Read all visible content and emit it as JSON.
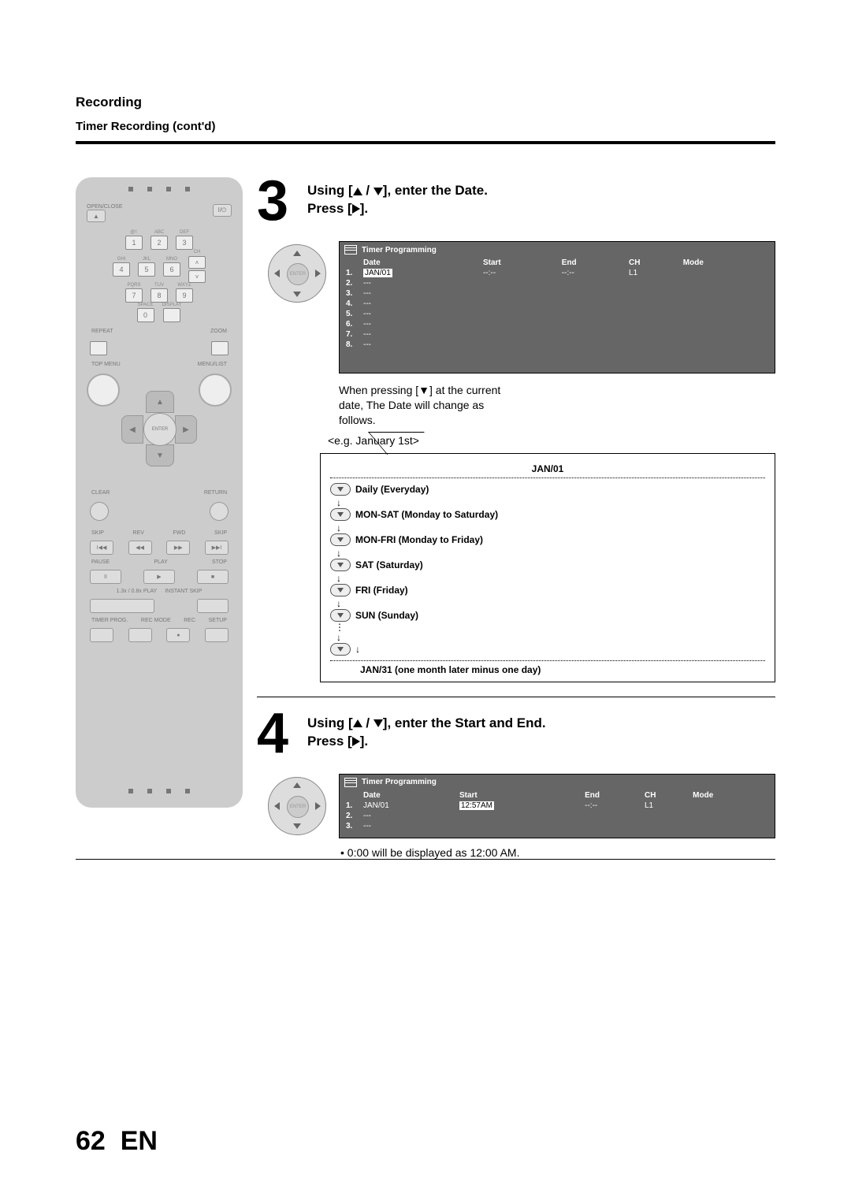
{
  "header": {
    "section": "Recording",
    "subsection": "Timer Recording (cont'd)"
  },
  "remote": {
    "open_close": "OPEN/CLOSE",
    "keypad": {
      "r1": [
        {
          "l": "@!:",
          "n": "1"
        },
        {
          "l": "ABC",
          "n": "2"
        },
        {
          "l": "DEF",
          "n": "3"
        }
      ],
      "r2": [
        {
          "l": "GHI",
          "n": "4"
        },
        {
          "l": "JKL",
          "n": "5"
        },
        {
          "l": "MNO",
          "n": "6"
        }
      ],
      "r3": [
        {
          "l": "PQRS",
          "n": "7"
        },
        {
          "l": "TUV",
          "n": "8"
        },
        {
          "l": "WXYZ",
          "n": "9"
        }
      ],
      "space": "SPACE",
      "zero": "0",
      "ch": "CH",
      "display": "DISPLAY"
    },
    "repeat": "REPEAT",
    "zoom": "ZOOM",
    "top_menu": "TOP MENU",
    "menu_list": "MENU/LIST",
    "enter": "ENTER",
    "clear": "CLEAR",
    "return": "RETURN",
    "transport": {
      "skip": "SKIP",
      "rev": "REV",
      "fwd": "FWD",
      "pause": "PAUSE",
      "play": "PLAY",
      "stop": "STOP",
      "speed": "1.3x / 0.8x PLAY",
      "instant": "INSTANT SKIP"
    },
    "bottom": {
      "timer_prog": "TIMER PROG.",
      "rec_mode": "REC MODE",
      "rec": "REC",
      "setup": "SETUP"
    }
  },
  "step3": {
    "line1_a": "Using [",
    "line1_b": " / ",
    "line1_c": "], enter the Date.",
    "line2_a": "Press [",
    "line2_b": "].",
    "osd_title": "Timer Programming",
    "cols": [
      "Date",
      "Start",
      "End",
      "CH",
      "Mode"
    ],
    "rows": [
      {
        "n": "1.",
        "date": "JAN/01",
        "start": "--:--",
        "end": "--:--",
        "ch": "L1",
        "hl": "date"
      },
      {
        "n": "2.",
        "date": "---"
      },
      {
        "n": "3.",
        "date": "---"
      },
      {
        "n": "4.",
        "date": "---"
      },
      {
        "n": "5.",
        "date": "---"
      },
      {
        "n": "6.",
        "date": "---"
      },
      {
        "n": "7.",
        "date": "---"
      },
      {
        "n": "8.",
        "date": "---"
      }
    ],
    "note": "When pressing [▼] at the current date, The Date will change as follows.",
    "example": "<e.g. January 1st>",
    "options_top": "JAN/01",
    "options": [
      "Daily (Everyday)",
      "MON-SAT (Monday to Saturday)",
      "MON-FRI (Monday to Friday)",
      "SAT (Saturday)",
      "FRI (Friday)",
      "SUN (Sunday)"
    ],
    "options_bottom": "JAN/31 (one month later minus one day)"
  },
  "step4": {
    "line1_a": "Using [",
    "line1_b": " / ",
    "line1_c": "], enter the Start and End.",
    "line2_a": "Press [",
    "line2_b": "].",
    "osd_title": "Timer Programming",
    "cols": [
      "Date",
      "Start",
      "End",
      "CH",
      "Mode"
    ],
    "rows": [
      {
        "n": "1.",
        "date": "JAN/01",
        "start": "12:57AM",
        "end": "--:--",
        "ch": "L1",
        "hl": "start"
      },
      {
        "n": "2.",
        "date": "---"
      },
      {
        "n": "3.",
        "date": "---"
      }
    ],
    "bullet": "• 0:00 will be displayed as 12:00 AM."
  },
  "footer": {
    "page": "62",
    "lang": "EN"
  }
}
